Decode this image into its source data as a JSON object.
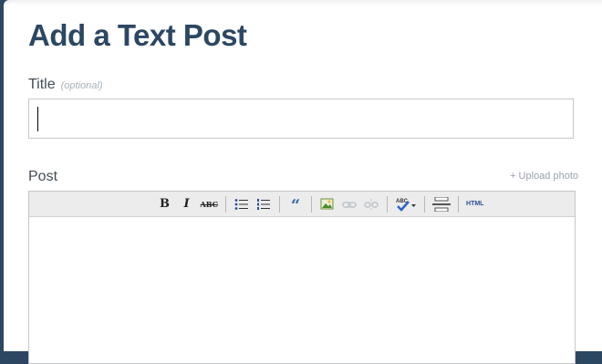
{
  "page": {
    "title": "Add a Text Post"
  },
  "title_field": {
    "label": "Title",
    "optional_note": "(optional)",
    "value": ""
  },
  "post_field": {
    "label": "Post",
    "upload_link": "+ Upload photo"
  },
  "toolbar": {
    "bold_label": "B",
    "italic_label": "I",
    "strike_label": "ABC",
    "quote_label": "“",
    "html_label": "HTML",
    "items": [
      "bold",
      "italic",
      "strikethrough",
      "bullet-list",
      "numbered-list",
      "blockquote",
      "insert-image",
      "insert-link",
      "remove-link",
      "spellcheck",
      "page-break",
      "html-source"
    ]
  },
  "colors": {
    "heading": "#2c4762",
    "background": "#2c4762",
    "toolbar": "#ececec",
    "link": "#9aa2ab"
  }
}
